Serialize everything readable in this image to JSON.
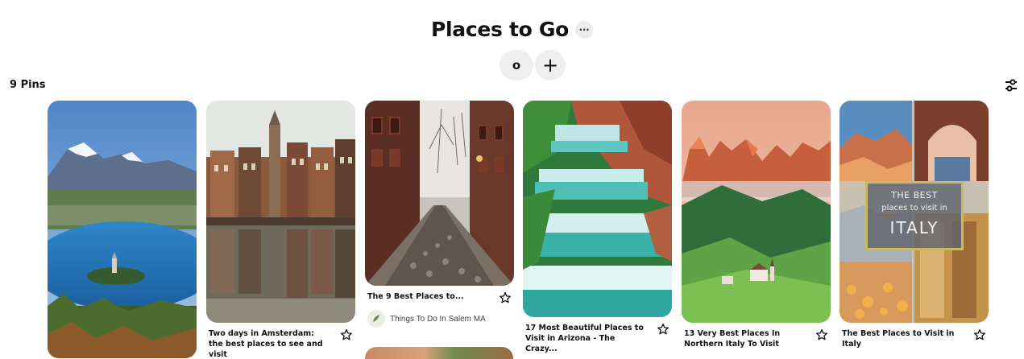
{
  "board": {
    "title": "Places to Go",
    "more_label": "···",
    "collaborator_initial": "o",
    "add_label": "+",
    "pin_count": "9 Pins"
  },
  "pins": [
    {
      "title": "",
      "image": "lake-island-mountains"
    },
    {
      "title": "Two days in Amsterdam: the best places to see and visit",
      "image": "amsterdam-canal"
    },
    {
      "title": "The 9 Best Places to...",
      "image": "cobblestone-street",
      "source": "Things To Do In Salem MA"
    },
    {
      "title": "17 Most Beautiful Places to Visit in Arizona - The Crazy...",
      "image": "turquoise-waterfall"
    },
    {
      "title": "13 Very Best Places In Northern Italy To Visit",
      "image": "dolomites-meadow"
    },
    {
      "title": "The Best Places to Visit in Italy",
      "image": "italy-collage",
      "overlay": {
        "line1": "THE BEST",
        "line2": "places to visit in",
        "line3": "ITALY"
      }
    }
  ],
  "colors": {
    "accent_gold": "#c9b86a",
    "text": "#111111",
    "button_bg": "#efefef"
  }
}
